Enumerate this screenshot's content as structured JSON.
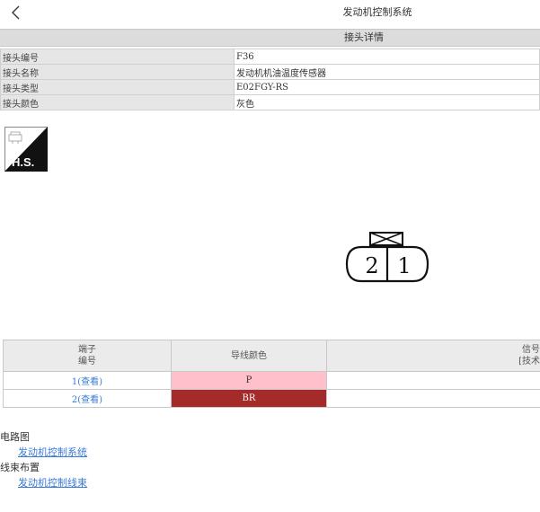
{
  "header": {
    "title": "发动机控制系统"
  },
  "section": {
    "title": "接头详情"
  },
  "connector_info": [
    {
      "label": "接头编号",
      "value": "F36"
    },
    {
      "label": "接头名称",
      "value": "发动机机油温度传感器"
    },
    {
      "label": "接头类型",
      "value": "E02FGY-RS"
    },
    {
      "label": "接头颜色",
      "value": "灰色"
    }
  ],
  "logo": {
    "text": "H.S."
  },
  "connector_diagram": {
    "pins": [
      "2",
      "1"
    ]
  },
  "pin_table": {
    "headers": {
      "pin_line1": "端子",
      "pin_line2": "编号",
      "wire_color": "导线颜色",
      "signal_line1": "信号",
      "signal_line2": "[技术"
    },
    "rows": [
      {
        "pin": "1(查看)",
        "wire_color": "P",
        "color_hex": "#ffc0cb",
        "text_hex": "#333333"
      },
      {
        "pin": "2(查看)",
        "wire_color": "BR",
        "color_hex": "#a52a2a",
        "text_hex": "#ffffff"
      }
    ]
  },
  "bottom": {
    "circuit_label": "电路图",
    "circuit_link": "发动机控制系统",
    "harness_label": "线束布置",
    "harness_link": "发动机控制线束"
  }
}
